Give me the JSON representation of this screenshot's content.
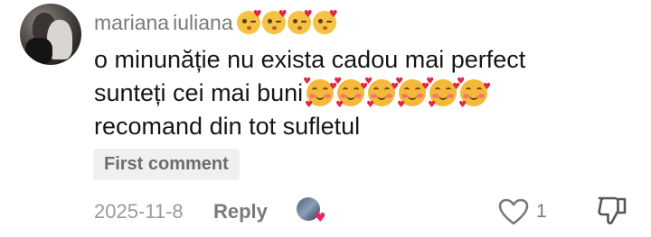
{
  "comment": {
    "username_first": "mariana",
    "username_second": "iuliana",
    "username_emojis": [
      "face-blowing-kiss",
      "face-blowing-kiss",
      "face-blowing-kiss",
      "face-blowing-kiss"
    ],
    "lines": [
      "o minunăție nu exista cadou mai perfect",
      "sunteți cei mai buni",
      "recomand din tot sufletul"
    ],
    "line2_emojis": [
      "smiling-face-with-hearts",
      "smiling-face-with-hearts",
      "smiling-face-with-hearts",
      "smiling-face-with-hearts",
      "smiling-face-with-hearts",
      "smiling-face-with-hearts"
    ],
    "badge": "First comment",
    "date": "2025-11-8",
    "reply_label": "Reply",
    "like_count": "1"
  },
  "icons": {
    "like": "heart-outline-icon",
    "dislike": "thumbs-down-icon",
    "liked_by": "creator-liked-avatar"
  },
  "colors": {
    "text": "#161616",
    "muted": "#7a7a7a",
    "badge_bg": "#f0f0f0",
    "heart_red": "#f0245f"
  }
}
